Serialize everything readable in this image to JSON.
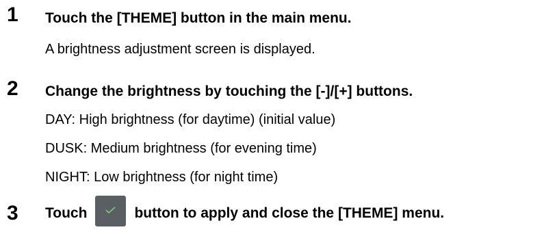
{
  "steps": [
    {
      "number": "1",
      "title": "Touch the [THEME] button in the main menu.",
      "lines": [
        "A brightness adjustment screen is displayed."
      ]
    },
    {
      "number": "2",
      "title": "Change the brightness by touching the [-]/[+] buttons.",
      "lines": [
        "DAY: High brightness (for daytime) (initial value)",
        "DUSK: Medium brightness (for evening time)",
        "NIGHT: Low brightness (for night time)"
      ]
    },
    {
      "number": "3",
      "title_before": "Touch",
      "title_after": "button to apply and close the [THEME] menu.",
      "icon": "check-icon",
      "button_color": "#5a5f63",
      "check_color": "#6fd36a"
    }
  ]
}
